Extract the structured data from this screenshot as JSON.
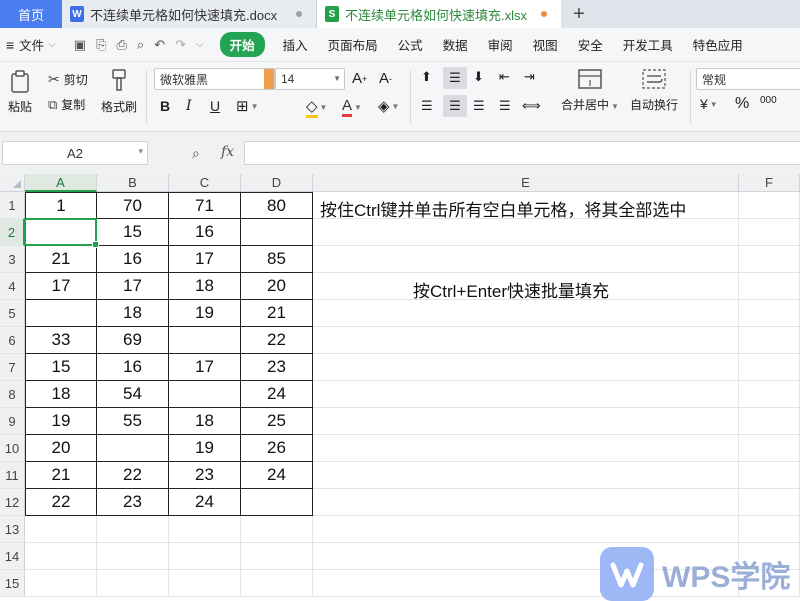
{
  "tabs": {
    "home": "首页",
    "doc1": "不连续单元格如何快速填充.docx",
    "doc2": "不连续单元格如何快速填充.xlsx"
  },
  "menu": {
    "file": "文件",
    "items": [
      "开始",
      "插入",
      "页面布局",
      "公式",
      "数据",
      "审阅",
      "视图",
      "安全",
      "开发工具",
      "特色应用"
    ]
  },
  "ribbon": {
    "paste": "粘贴",
    "cut": "剪切",
    "copy": "复制",
    "format_painter": "格式刷",
    "font_name": "微软雅黑",
    "font_size": "14",
    "bold": "B",
    "italic": "I",
    "underline": "U",
    "merge_center": "合并居中",
    "wrap_text": "自动换行",
    "number_format": "常规",
    "percent": "%",
    "thousands": "000"
  },
  "formula_bar": {
    "name_box": "A2",
    "fx": "fx",
    "formula": ""
  },
  "sheet": {
    "columns": [
      "A",
      "B",
      "C",
      "D",
      "E",
      "F"
    ],
    "rows": [
      "1",
      "2",
      "3",
      "4",
      "5",
      "6",
      "7",
      "8",
      "9",
      "10",
      "11",
      "12",
      "13",
      "14",
      "15"
    ],
    "data": [
      [
        "1",
        "70",
        "71",
        "80"
      ],
      [
        "",
        "15",
        "16",
        ""
      ],
      [
        "21",
        "16",
        "17",
        "85"
      ],
      [
        "17",
        "17",
        "18",
        "20"
      ],
      [
        "",
        "18",
        "19",
        "21"
      ],
      [
        "33",
        "69",
        "",
        "22"
      ],
      [
        "15",
        "16",
        "17",
        "23"
      ],
      [
        "18",
        "54",
        "",
        "24"
      ],
      [
        "19",
        "55",
        "18",
        "25"
      ],
      [
        "20",
        "",
        "19",
        "26"
      ],
      [
        "21",
        "22",
        "23",
        "24"
      ],
      [
        "22",
        "23",
        "24",
        ""
      ]
    ],
    "active_cell": "A2",
    "note1": "按住Ctrl键并单击所有空白单元格，将其全部选中",
    "note2": "按Ctrl+Enter快速批量填充"
  },
  "watermark": "WPS学院",
  "colors": {
    "accent": "#23a455",
    "home_tab": "#4a7df0",
    "font_arrow": "#f0a04b"
  }
}
